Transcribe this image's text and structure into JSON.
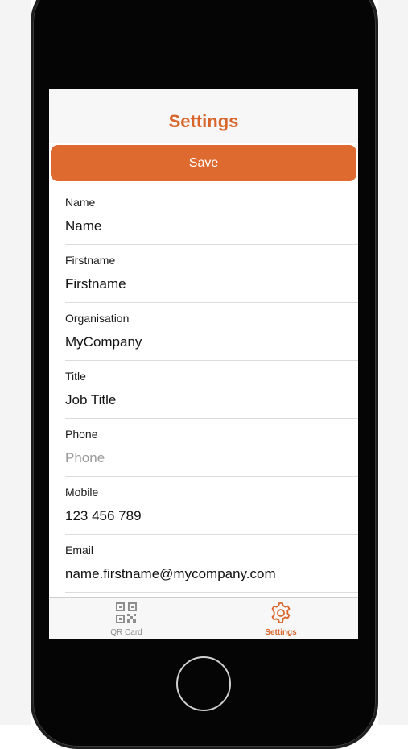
{
  "nav": {
    "title": "Settings"
  },
  "toolbar": {
    "save_label": "Save"
  },
  "fields": [
    {
      "label": "Name",
      "value": "Name",
      "placeholder": ""
    },
    {
      "label": "Firstname",
      "value": "Firstname",
      "placeholder": ""
    },
    {
      "label": "Organisation",
      "value": "MyCompany",
      "placeholder": ""
    },
    {
      "label": "Title",
      "value": "Job Title",
      "placeholder": ""
    },
    {
      "label": "Phone",
      "value": "",
      "placeholder": "Phone"
    },
    {
      "label": "Mobile",
      "value": "123 456 789",
      "placeholder": ""
    },
    {
      "label": "Email",
      "value": "name.firstname@mycompany.com",
      "placeholder": ""
    }
  ],
  "tabs": [
    {
      "label": "QR Card",
      "icon": "qr-code-icon",
      "active": false
    },
    {
      "label": "Settings",
      "icon": "gear-icon",
      "active": true
    }
  ],
  "colors": {
    "accent": "#de6a2f",
    "inactive_tab": "#8e8e8e",
    "divider": "#dcdcdc"
  }
}
